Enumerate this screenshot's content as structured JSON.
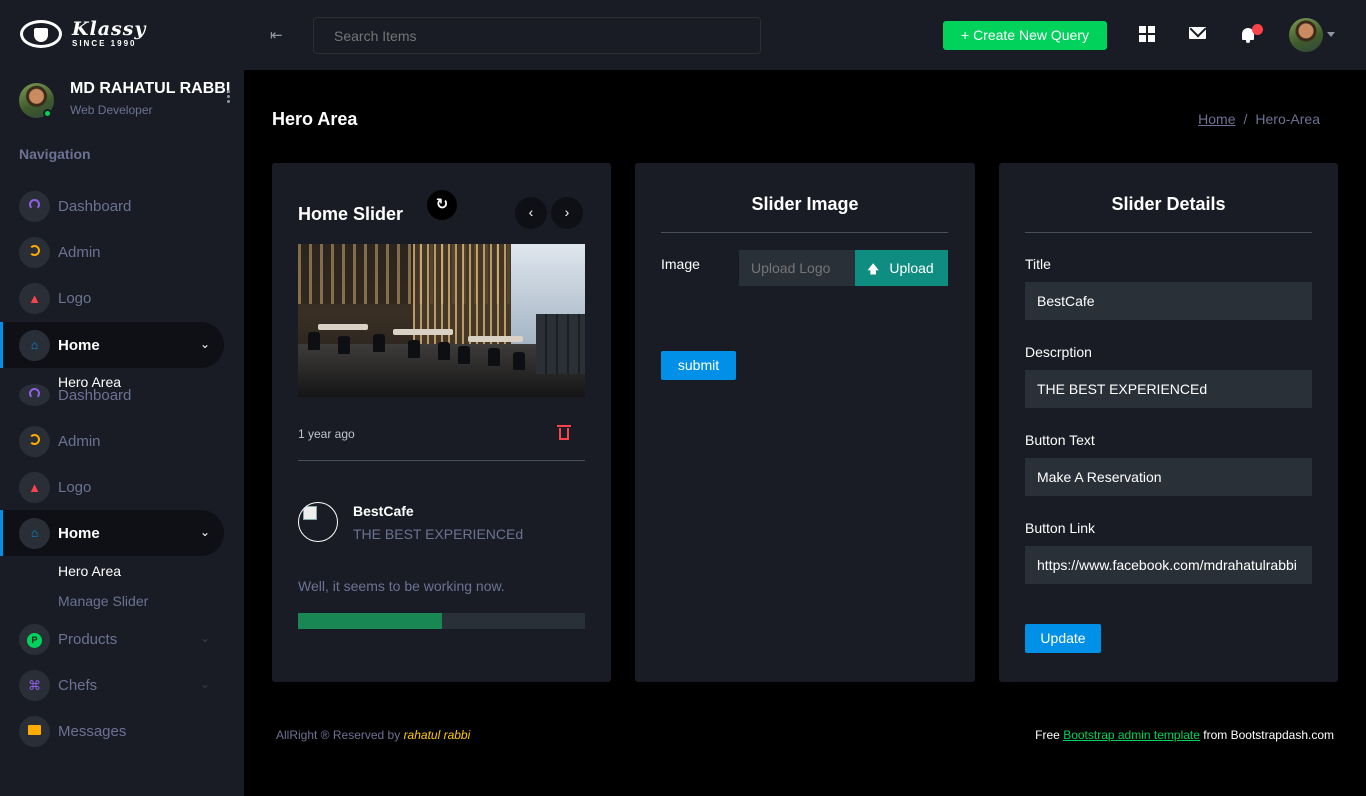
{
  "brand": {
    "name": "Klassy",
    "since": "SINCE 1990"
  },
  "header": {
    "search_placeholder": "Search Items",
    "create_button": "+ Create New Query"
  },
  "profile": {
    "name": "MD RAHATUL RABBI",
    "role": "Web Developer"
  },
  "sidebar": {
    "category": "Navigation",
    "items": [
      {
        "label": "Dashboard",
        "icon": "speedometer-icon",
        "color": "#8f5fe8"
      },
      {
        "label": "Admin",
        "icon": "playlist-icon",
        "color": "#ffab00"
      },
      {
        "label": "Logo",
        "icon": "chart-icon",
        "color": "#fc424a"
      },
      {
        "label": "Home",
        "icon": "home-icon",
        "color": "#0090e7"
      },
      {
        "label": "Dashboard",
        "icon": "speedometer-icon",
        "color": "#8f5fe8"
      },
      {
        "label": "Admin",
        "icon": "playlist-icon",
        "color": "#ffab00"
      },
      {
        "label": "Logo",
        "icon": "chart-icon",
        "color": "#fc424a"
      },
      {
        "label": "Home",
        "icon": "home-icon",
        "color": "#0090e7"
      },
      {
        "label": "Products",
        "icon": "p-icon",
        "color": "#00d25b"
      },
      {
        "label": "Chefs",
        "icon": "command-icon",
        "color": "#8f5fe8"
      },
      {
        "label": "Messages",
        "icon": "mail-icon",
        "color": "#ffab00"
      }
    ],
    "sub_items": {
      "hero_area": "Hero Area",
      "manage_slider": "Manage Slider"
    }
  },
  "page": {
    "title": "Hero Area"
  },
  "breadcrumb": {
    "home": "Home",
    "current": "Hero-Area"
  },
  "home_slider": {
    "title": "Home Slider",
    "time_ago": "1 year ago",
    "item_title": "BestCafe",
    "item_desc": "THE BEST EXPERIENCEd",
    "message": "Well, it seems to be working now.",
    "progress": 0.5
  },
  "slider_image": {
    "title": "Slider Image",
    "image_label": "Image",
    "upload_placeholder": "Upload Logo",
    "upload_button": "Upload",
    "submit_button": "submit"
  },
  "slider_details": {
    "title": "Slider Details",
    "title_label": "Title",
    "title_value": "BestCafe",
    "desc_label": "Descrption",
    "desc_value": "THE BEST EXPERIENCEd",
    "btn_text_label": "Button Text",
    "btn_text_value": "Make A Reservation",
    "btn_link_label": "Button Link",
    "btn_link_value": "https://www.facebook.com/mdrahatulrabbi",
    "update_button": "Update"
  },
  "footer": {
    "left_prefix": "AllRight ® Reserved by ",
    "left_author": "rahatul rabbi",
    "right_prefix": "Free ",
    "right_link": "Bootstrap admin template",
    "right_suffix": " from Bootstrapdash.com"
  }
}
